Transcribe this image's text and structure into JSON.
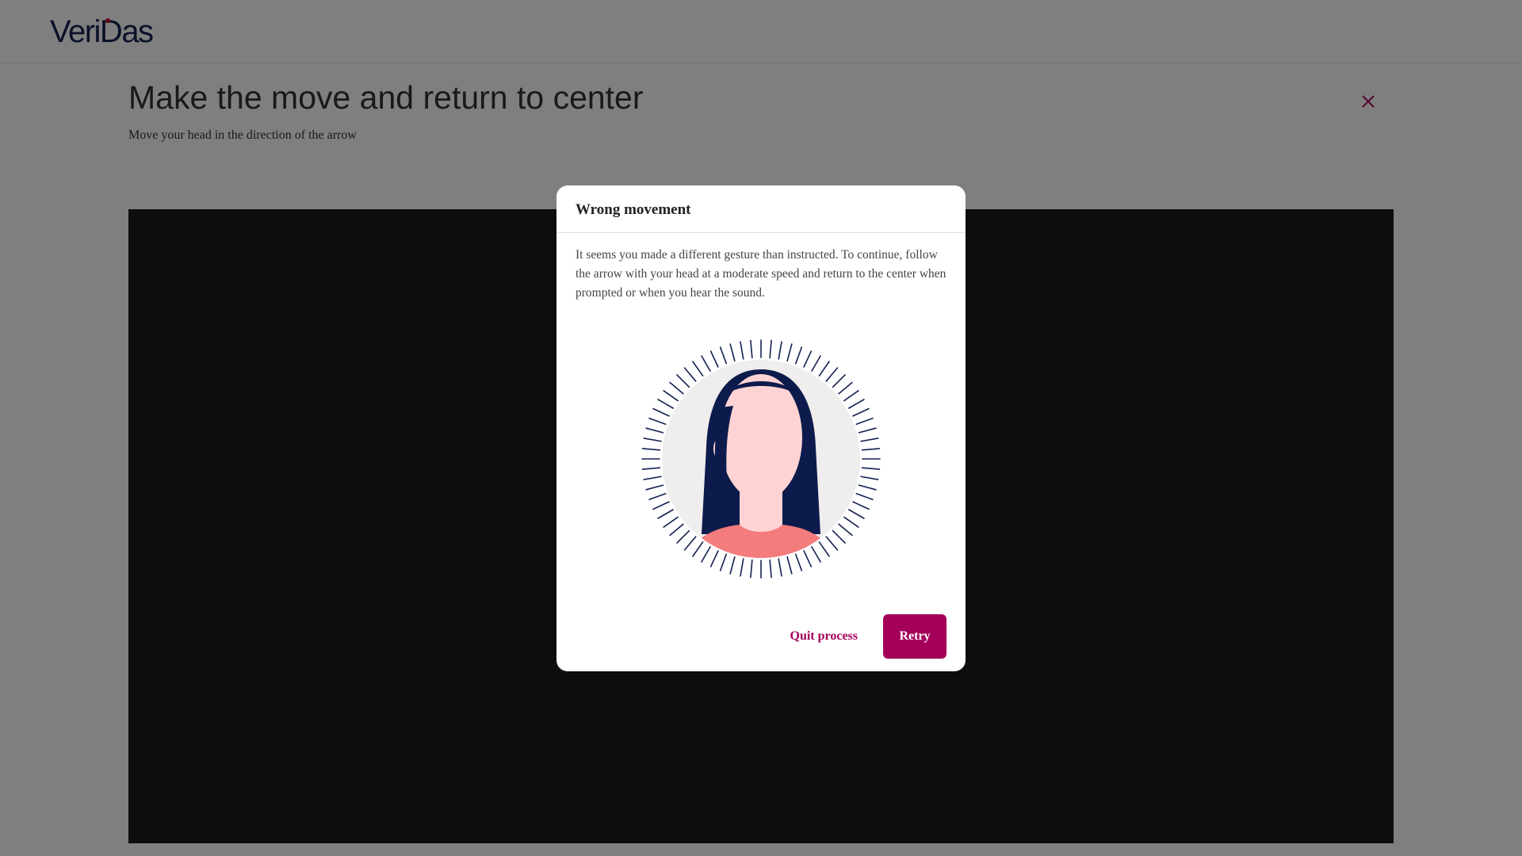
{
  "header": {
    "logo_text": "VeriDas"
  },
  "page": {
    "title": "Make the move and return to center",
    "subtitle": "Move your head in the direction of the arrow"
  },
  "modal": {
    "title": "Wrong movement",
    "message": "It seems you made a different gesture than instructed. To continue, follow the arrow with your head at a moderate speed and return to the center when prompted or when you hear the sound.",
    "quit_label": "Quit process",
    "retry_label": "Retry"
  },
  "icons": {
    "close": "close-icon",
    "illustration": "face-illustration"
  },
  "colors": {
    "brand_navy": "#142251",
    "accent": "#a4005a",
    "logo_dot": "#c8102e",
    "camera_bg": "#1a1a1a",
    "skin": "#ffd3d4",
    "hair": "#0d1b4c",
    "shirt": "#f47c7c"
  }
}
